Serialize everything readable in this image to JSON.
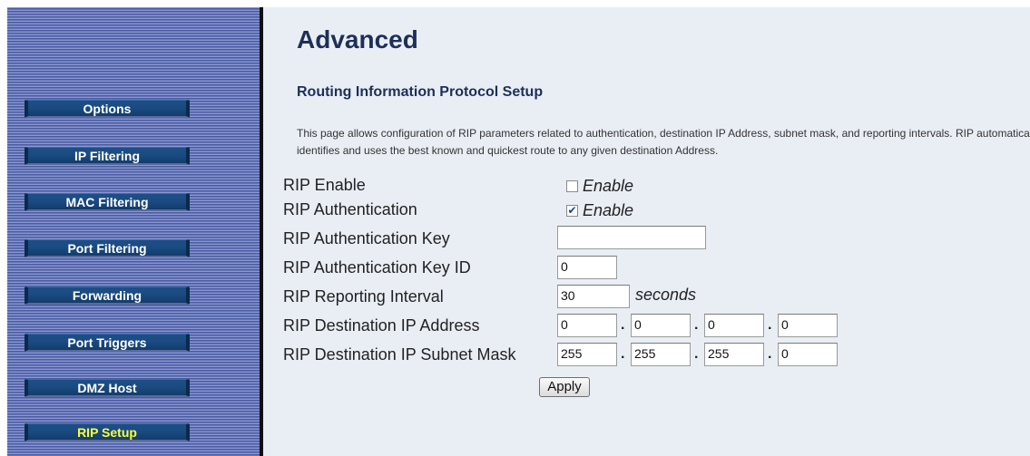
{
  "sidebar": {
    "items": [
      {
        "label": "Options"
      },
      {
        "label": "IP Filtering"
      },
      {
        "label": "MAC Filtering"
      },
      {
        "label": "Port Filtering"
      },
      {
        "label": "Forwarding"
      },
      {
        "label": "Port Triggers"
      },
      {
        "label": "DMZ Host"
      },
      {
        "label": "RIP Setup"
      }
    ],
    "active_item": "RIP Setup",
    "active_color": "#ffff33"
  },
  "main": {
    "title": "Advanced",
    "section_title": "Routing Information Protocol Setup",
    "description": "This page allows configuration of RIP parameters related to authentication, destination IP Address, subnet mask, and reporting intervals. RIP automatically identifies and uses the best known and quickest route to any given destination Address."
  },
  "form": {
    "rip_enable": {
      "label": "RIP Enable",
      "checkbox_label": "Enable",
      "checked": false
    },
    "rip_authentication": {
      "label": "RIP Authentication",
      "checkbox_label": "Enable",
      "checked": true
    },
    "auth_key": {
      "label": "RIP Authentication Key",
      "value": ""
    },
    "auth_key_id": {
      "label": "RIP Authentication Key ID",
      "value": "0"
    },
    "reporting_interval": {
      "label": "RIP Reporting Interval",
      "value": "30",
      "unit": "seconds"
    },
    "dest_ip": {
      "label": "RIP Destination IP Address",
      "octets": [
        "0",
        "0",
        "0",
        "0"
      ]
    },
    "subnet_mask": {
      "label": "RIP Destination IP Subnet Mask",
      "octets": [
        "255",
        "255",
        "255",
        "0"
      ]
    },
    "apply_label": "Apply",
    "octet_separator": "."
  }
}
